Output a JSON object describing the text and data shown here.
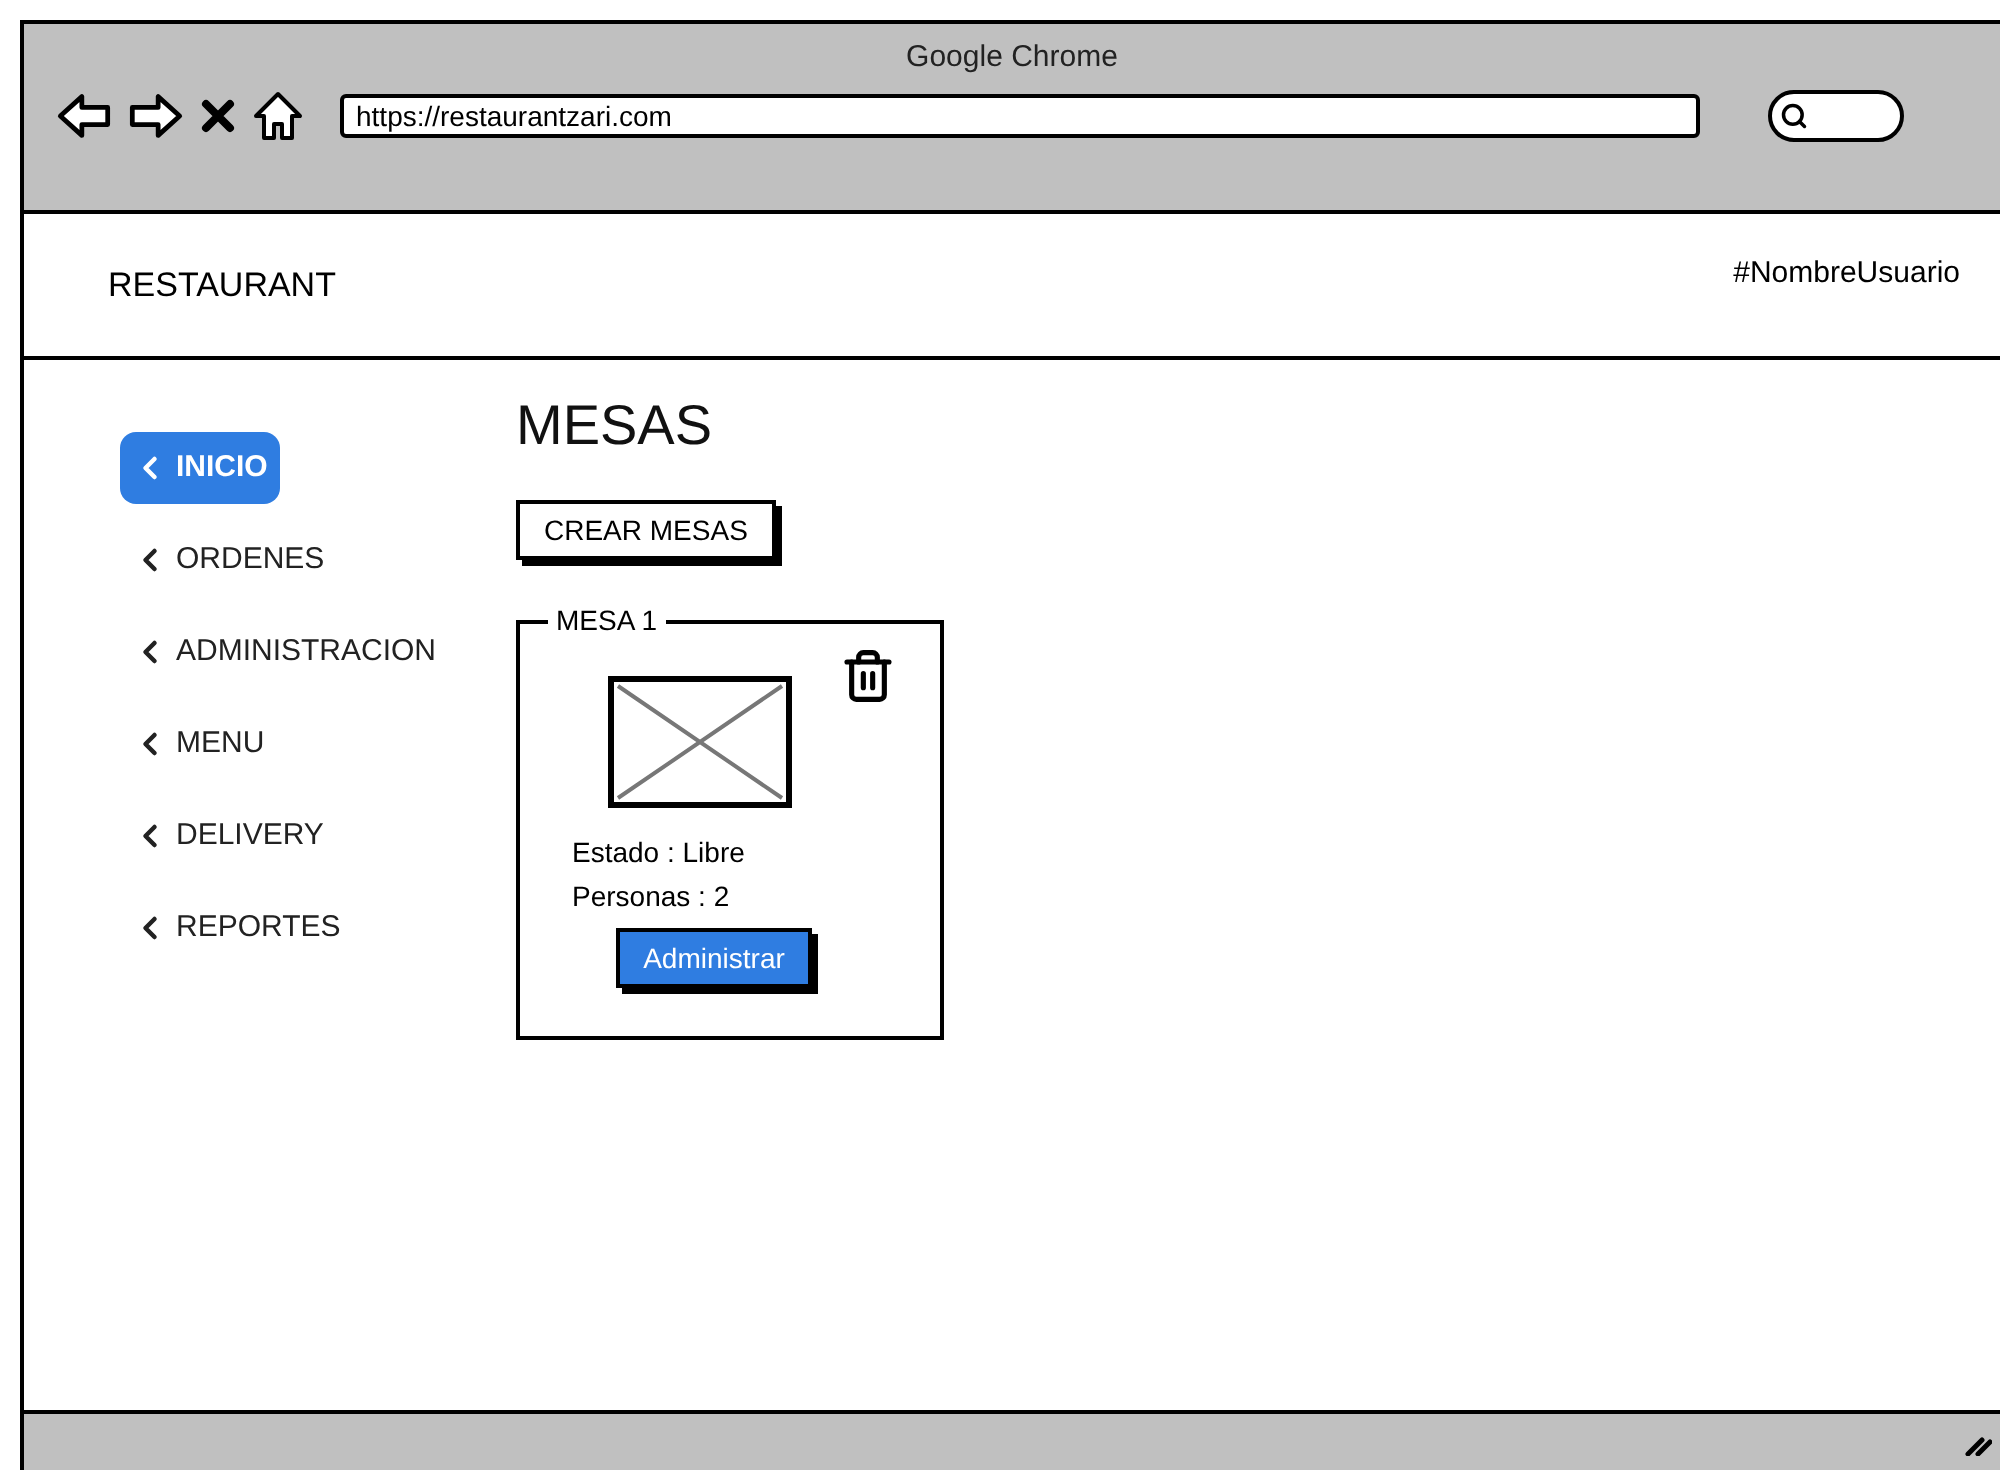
{
  "browser": {
    "title": "Google Chrome",
    "url": "https://restaurantzari.com"
  },
  "header": {
    "brand": "RESTAURANT",
    "user": "#NombreUsuario"
  },
  "sidebar": {
    "items": [
      {
        "label": "INICIO",
        "selected": true
      },
      {
        "label": "ORDENES",
        "selected": false
      },
      {
        "label": "ADMINISTRACION",
        "selected": false
      },
      {
        "label": "MENU",
        "selected": false
      },
      {
        "label": "DELIVERY",
        "selected": false
      },
      {
        "label": "REPORTES",
        "selected": false
      }
    ]
  },
  "page": {
    "title": "MESAS",
    "create_button": "CREAR MESAS",
    "tables": [
      {
        "name": "MESA 1",
        "lines": [
          "Estado : Libre",
          "Personas : 2"
        ],
        "action": "Administrar"
      }
    ]
  }
}
